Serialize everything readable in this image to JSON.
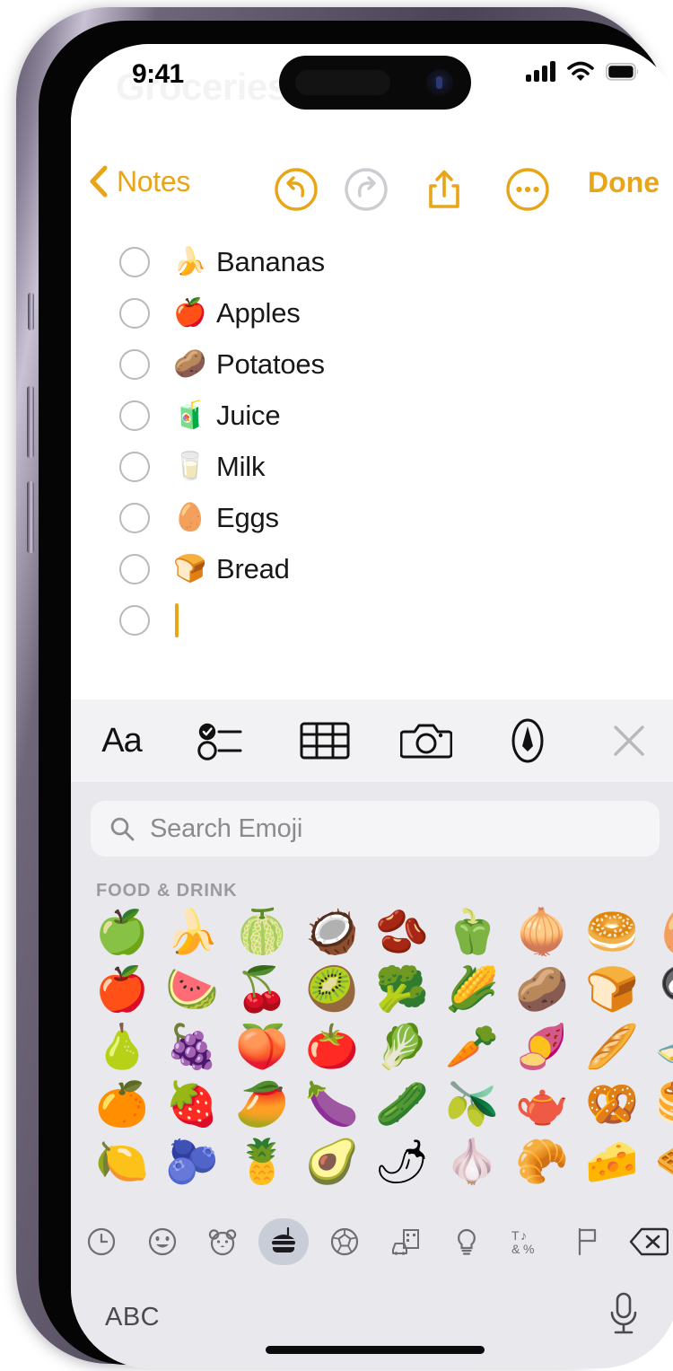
{
  "device": {
    "frame_color": "#6e6679",
    "buttons": [
      "silent-switch",
      "volume-up",
      "volume-down",
      "power"
    ]
  },
  "status_bar": {
    "time": "9:41",
    "signal_icon": "cellular-signal-icon",
    "wifi_icon": "wifi-icon",
    "battery_icon": "battery-full-icon"
  },
  "note": {
    "background_title": "Groceries",
    "accent_color": "#E8A517"
  },
  "nav_bar": {
    "back_label": "Notes",
    "back_icon": "chevron-left-icon",
    "undo_icon": "undo-arrow-icon",
    "redo_icon": "redo-arrow-icon",
    "share_icon": "share-square-up-arrow-icon",
    "more_icon": "ellipsis-circle-icon",
    "done_label": "Done"
  },
  "checklist": {
    "items": [
      {
        "emoji": "🍌",
        "emoji_name": "banana-emoji",
        "text": "Bananas",
        "checked": false
      },
      {
        "emoji": "🍎",
        "emoji_name": "red-apple-emoji",
        "text": "Apples",
        "checked": false
      },
      {
        "emoji": "🥔",
        "emoji_name": "potato-emoji",
        "text": "Potatoes",
        "checked": false
      },
      {
        "emoji": "🧃",
        "emoji_name": "beverage-box-emoji",
        "text": "Juice",
        "checked": false
      },
      {
        "emoji": "🥛",
        "emoji_name": "glass-of-milk-emoji",
        "text": "Milk",
        "checked": false
      },
      {
        "emoji": "🥚",
        "emoji_name": "egg-emoji",
        "text": "Eggs",
        "checked": false
      },
      {
        "emoji": "🍞",
        "emoji_name": "bread-emoji",
        "text": "Bread",
        "checked": false
      },
      {
        "emoji": "",
        "emoji_name": "empty-emoji",
        "text": "",
        "checked": false
      }
    ]
  },
  "format_toolbar": {
    "buttons": [
      {
        "label": "Aa",
        "name": "text-format-button"
      },
      {
        "label": "",
        "name": "checklist-button"
      },
      {
        "label": "",
        "name": "table-button"
      },
      {
        "label": "",
        "name": "camera-button"
      },
      {
        "label": "",
        "name": "markup-pen-button"
      },
      {
        "label": "",
        "name": "close-toolbar-button"
      }
    ]
  },
  "emoji_keyboard": {
    "search": {
      "placeholder": "Search Emoji",
      "value": "",
      "icon": "search-magnifier-icon"
    },
    "category_header": "FOOD & DRINK",
    "grid_rows": [
      [
        "🍏",
        "🍌",
        "🍈",
        "🥥",
        "🫘",
        "🫑",
        "🧅",
        "🥯",
        "🥚"
      ],
      [
        "🍎",
        "🍉",
        "🍒",
        "🥝",
        "🥦",
        "🌽",
        "🥔",
        "🍞",
        "🍳"
      ],
      [
        "🍐",
        "🍇",
        "🍑",
        "🍅",
        "🥬",
        "🥕",
        "🍠",
        "🥖",
        "🧈"
      ],
      [
        "🍊",
        "🍓",
        "🥭",
        "🍆",
        "🥒",
        "🫒",
        "🫖",
        "🥨",
        "🥞"
      ],
      [
        "🍋",
        "🫐",
        "🍍",
        "🥑",
        "🌶",
        "🧄",
        "🥐",
        "🧀",
        "🧇"
      ]
    ],
    "category_tabs": [
      {
        "name": "recent-clock-icon",
        "active": false
      },
      {
        "name": "smileys-people-icon",
        "active": false
      },
      {
        "name": "animals-nature-icon",
        "active": false
      },
      {
        "name": "food-drink-icon",
        "active": true
      },
      {
        "name": "activity-sports-icon",
        "active": false
      },
      {
        "name": "travel-places-icon",
        "active": false
      },
      {
        "name": "objects-bulb-icon",
        "active": false
      },
      {
        "name": "symbols-icon",
        "active": false
      },
      {
        "name": "flags-icon",
        "active": false
      },
      {
        "name": "delete-backspace-icon",
        "active": false
      }
    ],
    "bottom": {
      "abc_label": "ABC",
      "mic_icon": "microphone-icon"
    }
  }
}
